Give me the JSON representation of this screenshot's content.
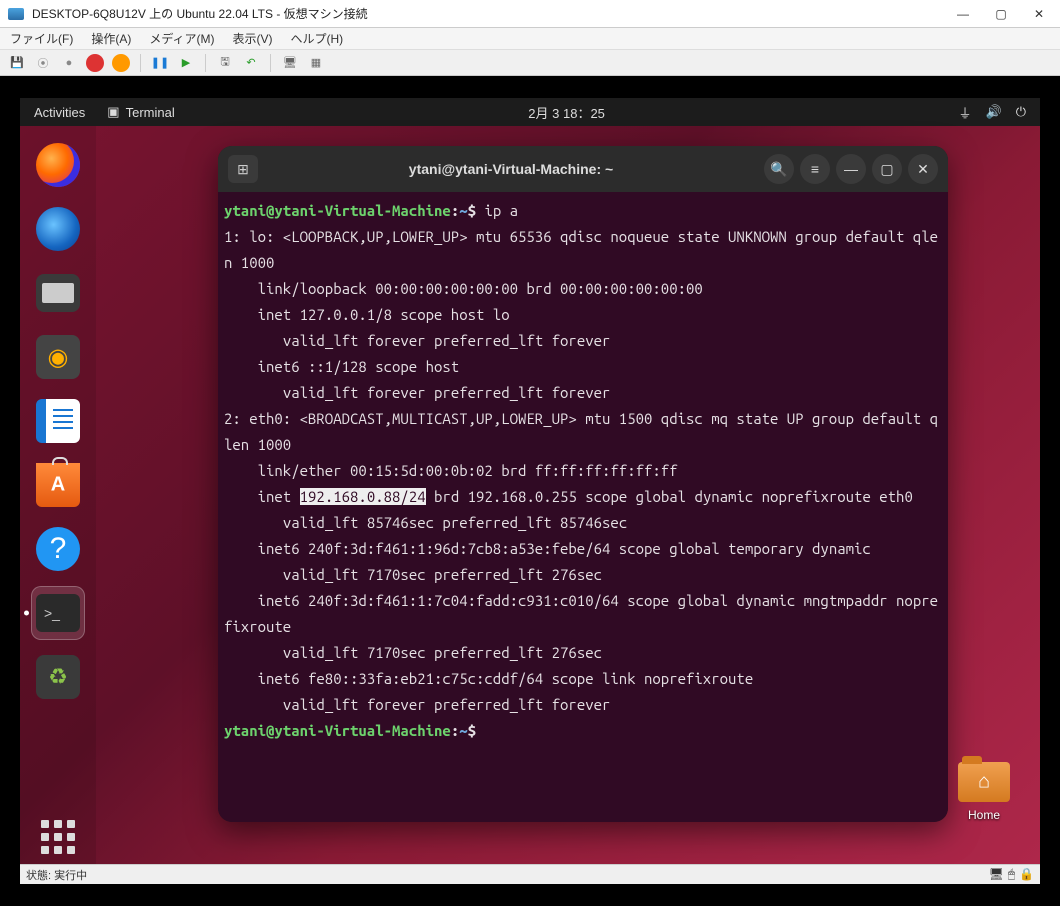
{
  "vm": {
    "title": "DESKTOP-6Q8U12V 上の Ubuntu 22.04 LTS  - 仮想マシン接続",
    "menus": [
      "ファイル(F)",
      "操作(A)",
      "メディア(M)",
      "表示(V)",
      "ヘルプ(H)"
    ]
  },
  "ubuntuBar": {
    "activities": "Activities",
    "appLabel": "Terminal",
    "clock": "2月 3 18：25"
  },
  "dock": {
    "items": [
      {
        "name": "firefox",
        "label": "Firefox"
      },
      {
        "name": "thunderbird",
        "label": "Thunderbird"
      },
      {
        "name": "files",
        "label": "Files"
      },
      {
        "name": "rhythmbox",
        "label": "Rhythmbox"
      },
      {
        "name": "writer",
        "label": "LibreOffice Writer"
      },
      {
        "name": "software",
        "label": "Ubuntu Software"
      },
      {
        "name": "help",
        "label": "Help"
      },
      {
        "name": "terminal",
        "label": "Terminal"
      },
      {
        "name": "trash",
        "label": "Trash"
      }
    ]
  },
  "terminal": {
    "title": "ytani@ytani-Virtual-Machine: ~",
    "prompt_user": "ytani@ytani-Virtual-Machine",
    "prompt_sep": ":",
    "prompt_path": "~",
    "prompt_sym": "$",
    "cmd": "ip a",
    "out_pre": "1: lo: <LOOPBACK,UP,LOWER_UP> mtu 65536 qdisc noqueue state UNKNOWN group default qlen 1000\n    link/loopback 00:00:00:00:00:00 brd 00:00:00:00:00:00\n    inet 127.0.0.1/8 scope host lo\n       valid_lft forever preferred_lft forever\n    inet6 ::1/128 scope host\n       valid_lft forever preferred_lft forever\n2: eth0: <BROADCAST,MULTICAST,UP,LOWER_UP> mtu 1500 qdisc mq state UP group default qlen 1000\n    link/ether 00:15:5d:00:0b:02 brd ff:ff:ff:ff:ff:ff\n    inet ",
    "highlight": "192.168.0.88/24",
    "out_post": " brd 192.168.0.255 scope global dynamic noprefixroute eth0\n       valid_lft 85746sec preferred_lft 85746sec\n    inet6 240f:3d:f461:1:96d:7cb8:a53e:febe/64 scope global temporary dynamic\n       valid_lft 7170sec preferred_lft 276sec\n    inet6 240f:3d:f461:1:7c04:fadd:c931:c010/64 scope global dynamic mngtmpaddr noprefixroute\n       valid_lft 7170sec preferred_lft 276sec\n    inet6 fe80::33fa:eb21:c75c:cddf/64 scope link noprefixroute\n       valid_lft forever preferred_lft forever"
  },
  "home": {
    "label": "Home"
  },
  "status": {
    "text": "状態: 実行中"
  }
}
